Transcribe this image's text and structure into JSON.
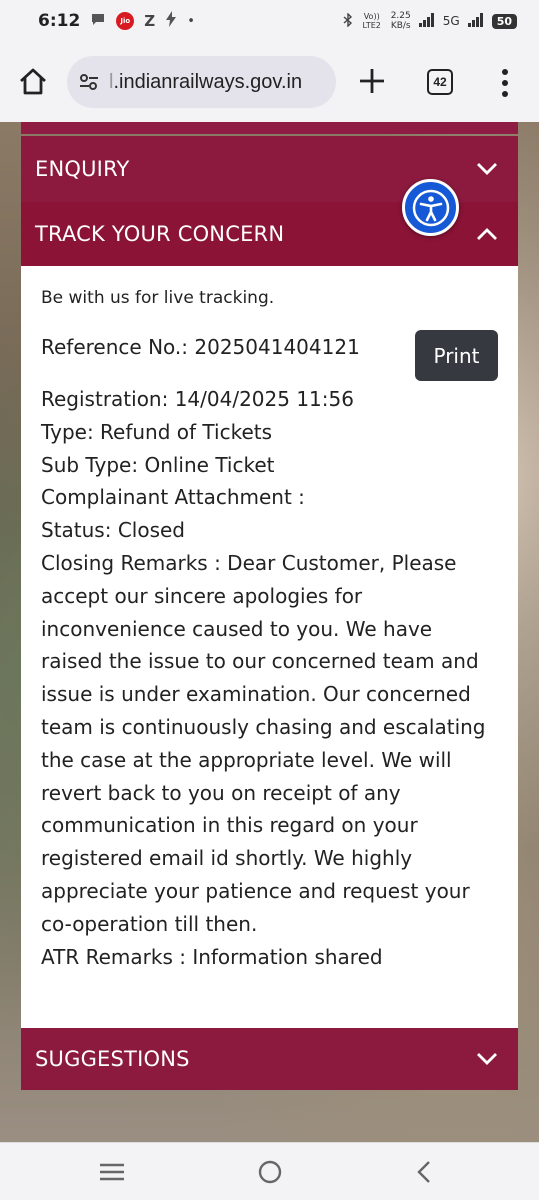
{
  "status_bar": {
    "time": "6:12",
    "carrier_badge": "Jio",
    "letter_z": "Z",
    "dot": "•",
    "network_volte": "Vo)) LTE2",
    "speed_value": "2.25",
    "speed_unit": "KB/s",
    "network_5g": "5G",
    "battery": "50"
  },
  "browser": {
    "url_faded": "l",
    "url": ".indianrailways.gov.in",
    "tab_count": "42",
    "icons": [
      "home-icon",
      "tune-icon",
      "plus-icon",
      "tabs-icon",
      "more-vert-icon"
    ]
  },
  "sections": {
    "enquiry": "ENQUIRY",
    "track": "TRACK YOUR CONCERN",
    "suggestions": "SUGGESTIONS"
  },
  "track": {
    "intro": "Be with us for live tracking.",
    "reference": "Reference No.: 2025041404121",
    "print_label": "Print",
    "registration": "Registration: 14/04/2025 11:56",
    "type": "Type: Refund of Tickets",
    "sub_type": "Sub Type: Online Ticket",
    "attachment": "Complainant Attachment :",
    "status": "Status: Closed",
    "closing_remarks": "Closing Remarks : Dear Customer, Please accept our sincere apologies for inconvenience caused to you. We have raised the issue to our concerned team and issue is under examination. Our concerned team is continuously chasing and escalating the case at the appropriate level. We will revert back to you on receipt of any communication in this regard on your registered email id shortly. We highly appreciate your patience and request your co-operation till then.",
    "atr_remarks": "ATR Remarks : Information shared"
  },
  "colors": {
    "header_maroon": "#8a1538",
    "accessibility_blue": "#1559d6",
    "print_button": "#363a40"
  }
}
